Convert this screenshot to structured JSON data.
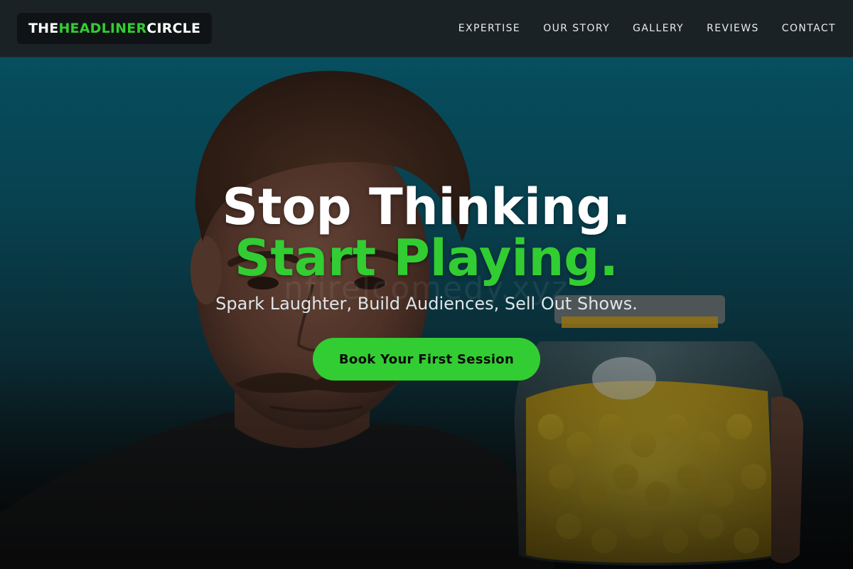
{
  "brand": {
    "part1": "THE ",
    "accent": "HEADLINER",
    "part2": " CIRCLE",
    "accent_color": "#32cd32"
  },
  "nav": {
    "items": [
      {
        "label": "EXPERTISE"
      },
      {
        "label": "OUR STORY"
      },
      {
        "label": "GALLERY"
      },
      {
        "label": "REVIEWS"
      },
      {
        "label": "CONTACT"
      }
    ]
  },
  "hero": {
    "title_line1": "Stop Thinking.",
    "title_line2": "Start Playing.",
    "subtitle": "Spark Laughter, Build Audiences, Sell Out Shows.",
    "cta_label": "Book Your First Session",
    "watermark": "nfirelcomedy.xyz",
    "background_image": "man-with-mustache-holding-jar-of-yellow-candy"
  },
  "colors": {
    "accent": "#32cd32",
    "header_bg": "#1b2226",
    "hero_teal": "#0a6d84"
  }
}
